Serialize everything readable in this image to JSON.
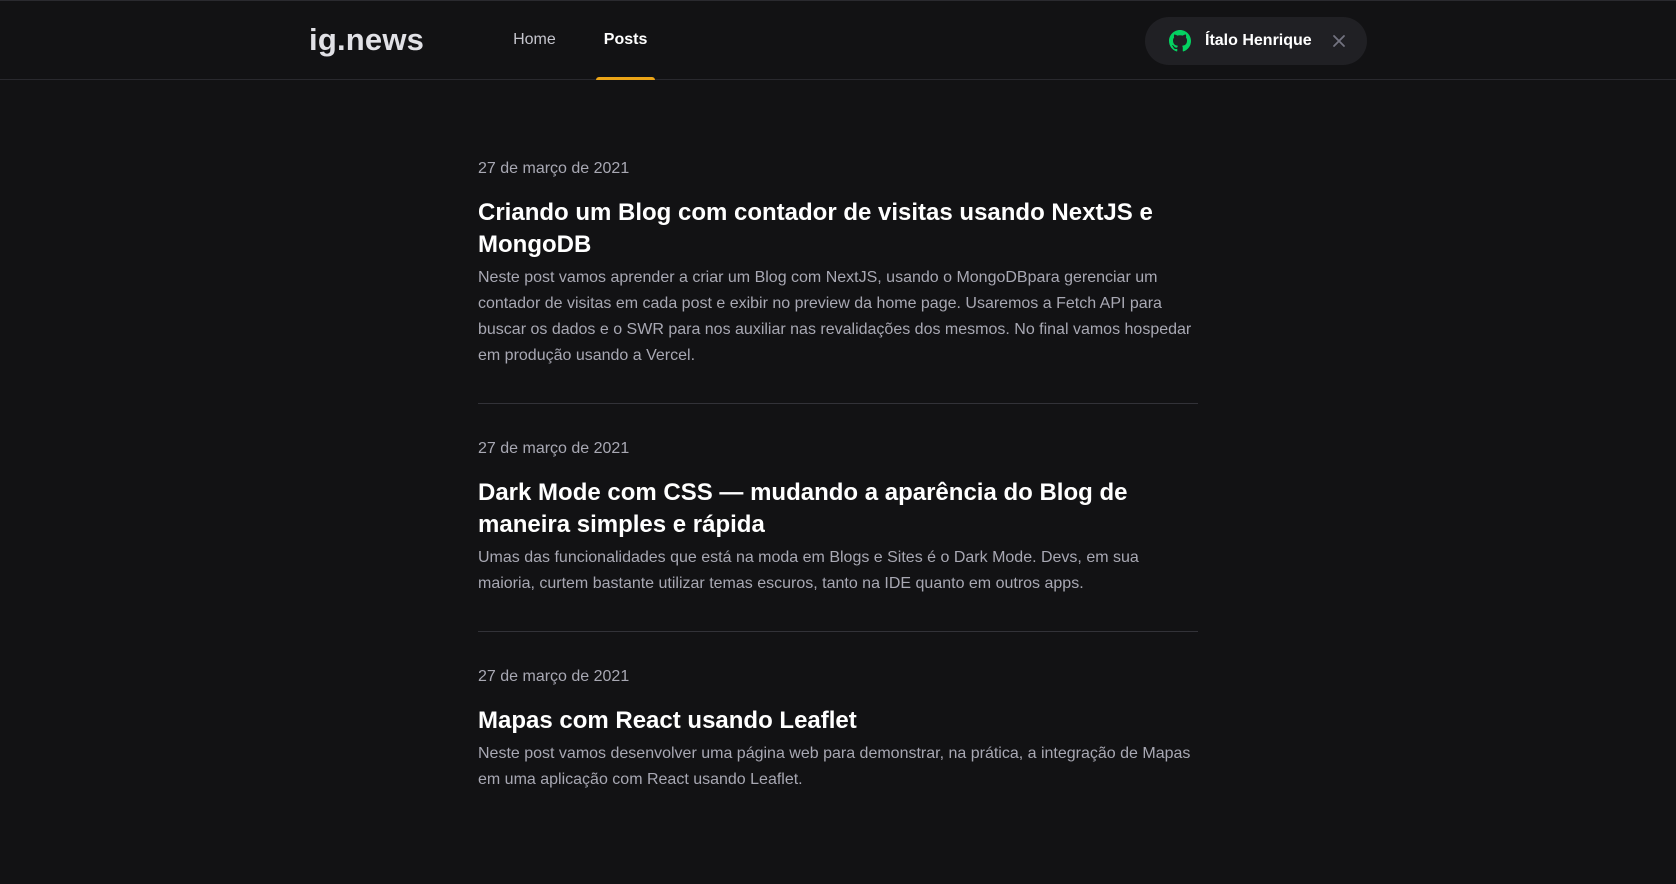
{
  "app": {
    "logo": "ig.news"
  },
  "nav": {
    "items": [
      {
        "label": "Home",
        "active": false
      },
      {
        "label": "Posts",
        "active": true
      }
    ]
  },
  "user": {
    "name": "Ítalo Henrique",
    "provider_icon": "github-icon",
    "close_icon": "close-icon"
  },
  "colors": {
    "background": "#121214",
    "accent": "#eba417",
    "github_green": "#04d361"
  },
  "posts": [
    {
      "date": "27 de março de 2021",
      "title": "Criando um Blog com contador de visitas usando NextJS e MongoDB",
      "excerpt": "Neste post vamos aprender a criar um Blog com NextJS, usando o MongoDBpara gerenciar um contador de visitas em cada post e exibir no preview da home page. Usaremos a Fetch API para buscar os dados e o SWR para nos auxiliar nas revalidações dos mesmos. No final vamos hospedar em produção usando a Vercel."
    },
    {
      "date": "27 de março de 2021",
      "title": "Dark Mode com CSS — mudando a aparência do Blog de maneira simples e rápida",
      "excerpt": "Umas das funcionalidades que está na moda em Blogs e Sites é o Dark Mode. Devs, em sua maioria, curtem bastante utilizar temas escuros, tanto na IDE quanto em outros apps."
    },
    {
      "date": "27 de março de 2021",
      "title": "Mapas com React usando Leaflet",
      "excerpt": "Neste post vamos desenvolver uma página web para demonstrar, na prática, a integração de Mapas em uma aplicação com React usando Leaflet."
    }
  ]
}
